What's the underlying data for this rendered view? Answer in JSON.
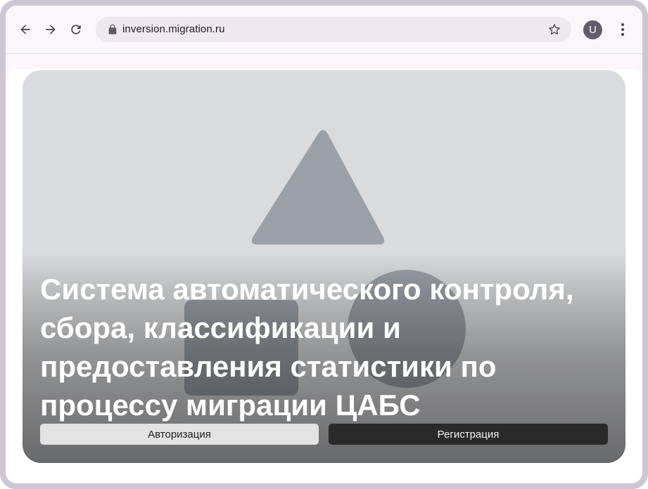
{
  "browser": {
    "url": "inversion.migration.ru",
    "profile_initial": "U",
    "icons": [
      "back-arrow-icon",
      "forward-arrow-icon",
      "reload-icon",
      "lock-icon",
      "bookmark-star-icon",
      "more-vert-icon"
    ]
  },
  "hero": {
    "title": "Система автоматического контроля, сбора, классификации и предоставления статистики по процессу миграции ЦАБС",
    "image": "placeholder-image-shapes"
  },
  "actions": {
    "login_label": "Авторизация",
    "register_label": "Регистрация"
  },
  "colors": {
    "frame": "#cdc6d4",
    "omnibox": "#efe8f1",
    "placeholder_bg": "#dadbde",
    "placeholder_shape": "#9aa0a6",
    "login_button": "#e3e3e4",
    "register_button": "#2a2a2a"
  }
}
